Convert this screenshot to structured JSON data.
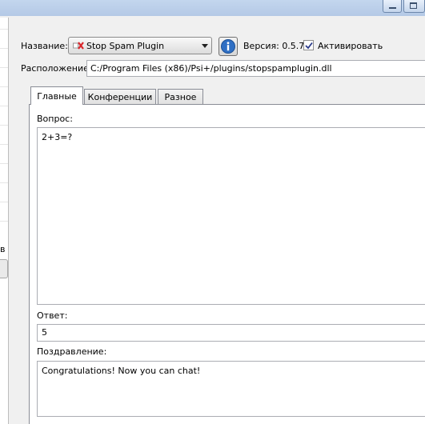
{
  "window": {
    "minimize_icon": "minimize-icon",
    "maximize_icon": "maximize-icon"
  },
  "side": {
    "partial_text": "в"
  },
  "plugin": {
    "name_label": "Название:",
    "selected_plugin": "Stop Spam Plugin",
    "version_label": "Версия: 0.5.7",
    "activate_label": "Активировать",
    "activate_checked": true,
    "location_label": "Расположение:",
    "location_value": "C:/Program Files (x86)/Psi+/plugins/stopspamplugin.dll"
  },
  "tabs": [
    {
      "label": "Главные",
      "active": true
    },
    {
      "label": "Конференции",
      "active": false
    },
    {
      "label": "Разное",
      "active": false
    }
  ],
  "form": {
    "question_label": "Вопрос:",
    "question_value": "2+3=?",
    "answer_label": "Ответ:",
    "answer_value": "5",
    "congrats_label": "Поздравление:",
    "congrats_value": "Congratulations! Now you can chat!"
  },
  "colors": {
    "info_icon_fill": "#2f6fc4",
    "plugin_icon_red": "#d9262b"
  }
}
